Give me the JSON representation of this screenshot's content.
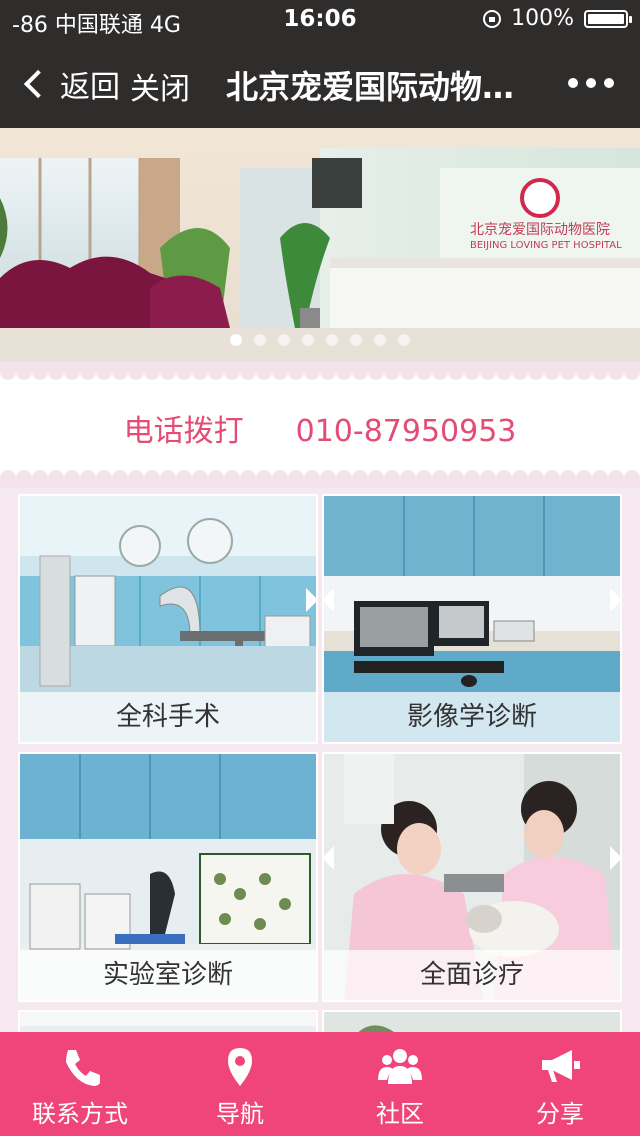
{
  "status_bar": {
    "carrier": "-86 中国联通  4G",
    "time": "16:06",
    "battery": "100%",
    "battery_level": 1.0
  },
  "nav": {
    "back_label": "返回",
    "close_label": "关闭",
    "title": "北京宠爱国际动物医院"
  },
  "banner": {
    "slide_count": 8,
    "active_index": 0,
    "logo_text": "北京宠爱国际动物医院",
    "logo_subtext": "BEIJING LOVING PET HOSPITAL"
  },
  "contact": {
    "label": "电话拨打",
    "phone": "010-87950953"
  },
  "services": [
    {
      "label": "全科手术"
    },
    {
      "label": "影像学诊断"
    },
    {
      "label": "实验室诊断"
    },
    {
      "label": "全面诊疗"
    }
  ],
  "tabbar": {
    "items": [
      {
        "label": "联系方式",
        "icon": "phone-icon"
      },
      {
        "label": "导航",
        "icon": "location-pin-icon"
      },
      {
        "label": "社区",
        "icon": "community-icon"
      },
      {
        "label": "分享",
        "icon": "megaphone-icon"
      }
    ]
  },
  "colors": {
    "accent": "#f0457a",
    "phone_text": "#e44c77",
    "bar_dark": "#2f2c2c",
    "background": "#f5e9ef"
  }
}
